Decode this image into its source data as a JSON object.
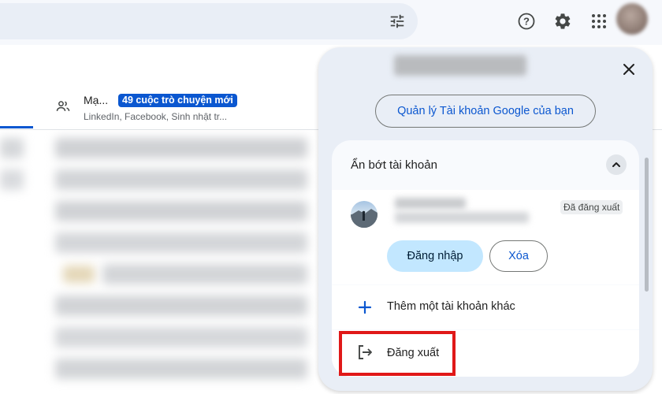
{
  "main": {
    "tab": {
      "title": "Mạ...",
      "badge": "49 cuộc trò chuyện mới",
      "subtitle": "LinkedIn, Facebook, Sinh nhật tr..."
    }
  },
  "account_panel": {
    "manage_button": "Quản lý Tài khoản Google của bạn",
    "section_header": "Ẩn bớt tài khoản",
    "account": {
      "status_badge": "Đã đăng xuất",
      "signin_button": "Đăng nhập",
      "remove_button": "Xóa"
    },
    "add_account_label": "Thêm một tài khoản khác",
    "signout_label": "Đăng xuất"
  },
  "icons": {
    "tune": "tune-icon",
    "help": "help-icon",
    "settings": "gear-icon",
    "apps": "apps-grid-icon",
    "close": "close-icon",
    "chevron": "chevron-up-icon",
    "add": "plus-icon",
    "signout": "logout-icon",
    "people": "people-icon"
  },
  "colors": {
    "accent": "#0b57d0",
    "highlight": "#e01818",
    "signin_bg": "#c2e7ff"
  }
}
